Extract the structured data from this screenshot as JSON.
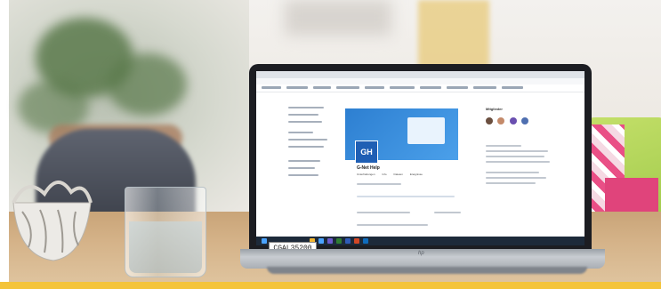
{
  "photo": {
    "description_free": "",
    "screen": {
      "group_logo_text": "GH",
      "group_title": "G-Net Help",
      "tab_labels": [
        "Unterhaltungen",
        "Info",
        "Dateien",
        "Ereignisse"
      ],
      "members_label": "Mitglieder"
    },
    "sticker_text": "CGAL35200"
  },
  "colors": {
    "hero_blue": "#2d7fd1",
    "logo_blue": "#1f5fb4",
    "chair_green": "#9ec94a",
    "cushion_pink": "#e94f86",
    "taskbar": "#1d2a3a"
  }
}
